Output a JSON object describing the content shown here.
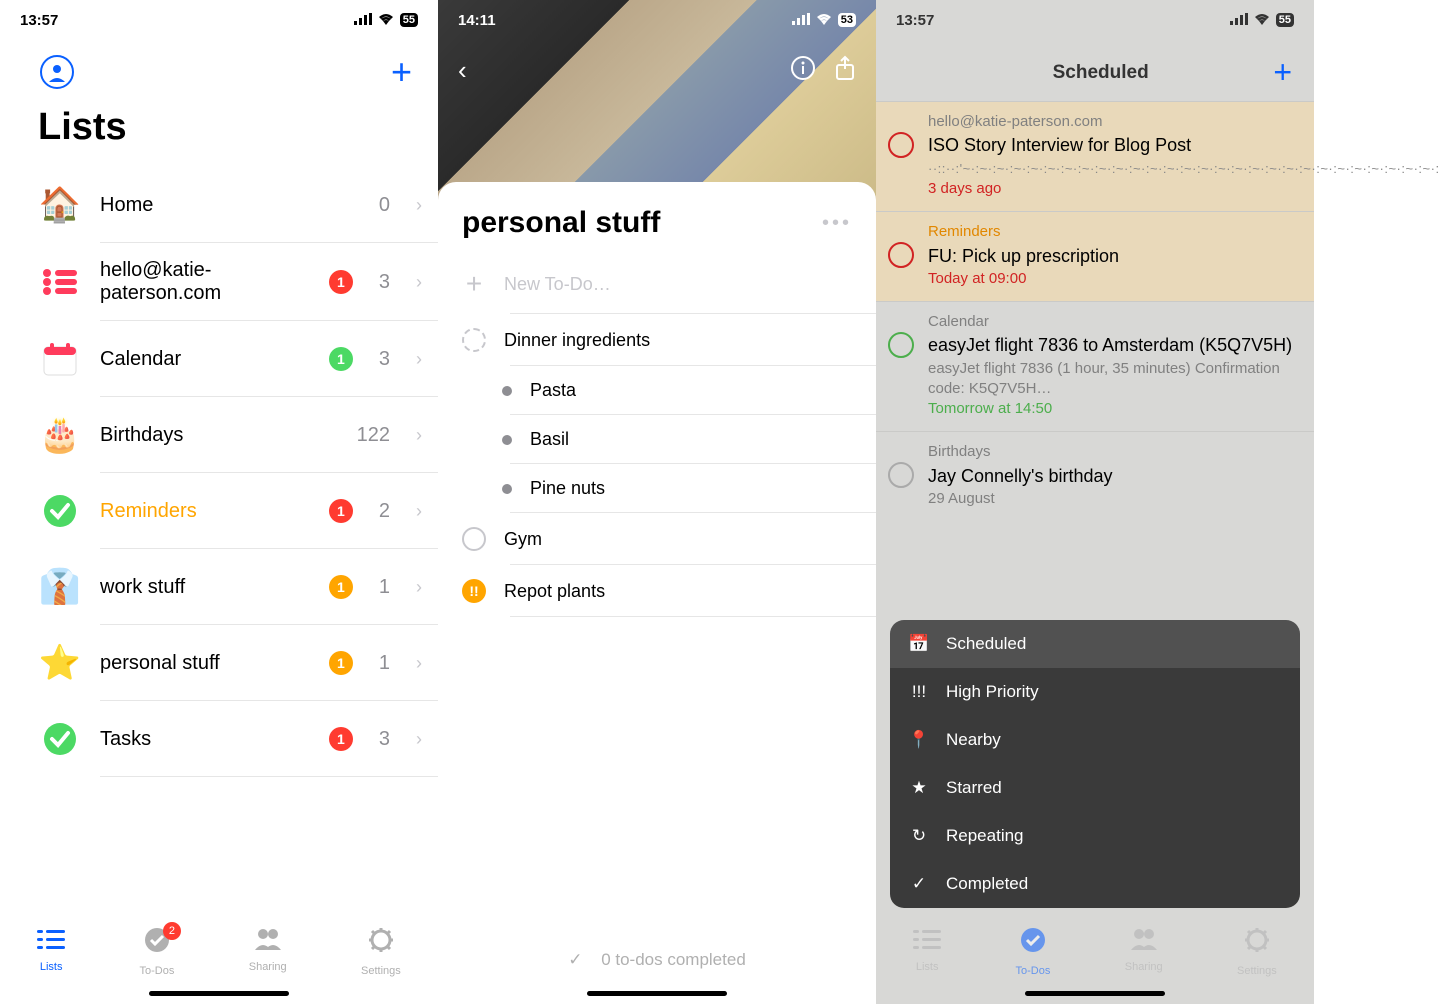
{
  "screen1": {
    "time": "13:57",
    "battery": "55",
    "title": "Lists",
    "lists": [
      {
        "icon": "🏠",
        "label": "Home",
        "badge": null,
        "badgeColor": null,
        "count": "0"
      },
      {
        "icon": "list",
        "label": "hello@katie-paterson.com",
        "badge": "1",
        "badgeColor": "#ff3b30",
        "count": "3"
      },
      {
        "icon": "calendar",
        "label": "Calendar",
        "badge": "1",
        "badgeColor": "#4cd964",
        "count": "3"
      },
      {
        "icon": "🎂",
        "label": "Birthdays",
        "badge": null,
        "badgeColor": null,
        "count": "122"
      },
      {
        "icon": "check",
        "label": "Reminders",
        "labelColor": "#ffa500",
        "badge": "1",
        "badgeColor": "#ff3b30",
        "count": "2"
      },
      {
        "icon": "👔",
        "label": "work stuff",
        "badge": "1",
        "badgeColor": "#ffa500",
        "count": "1"
      },
      {
        "icon": "⭐",
        "label": "personal stuff",
        "badge": "1",
        "badgeColor": "#ffa500",
        "count": "1"
      },
      {
        "icon": "check",
        "label": "Tasks",
        "badge": "1",
        "badgeColor": "#ff3b30",
        "count": "3"
      }
    ],
    "tabs": [
      {
        "label": "Lists",
        "active": true,
        "badge": null
      },
      {
        "label": "To-Dos",
        "active": false,
        "badge": "2"
      },
      {
        "label": "Sharing",
        "active": false,
        "badge": null
      },
      {
        "label": "Settings",
        "active": false,
        "badge": null
      }
    ]
  },
  "screen2": {
    "time": "14:11",
    "battery": "53",
    "title": "personal stuff",
    "newTodo": "New To-Do…",
    "todos": [
      {
        "type": "dashed",
        "label": "Dinner ingredients"
      },
      {
        "type": "bullet",
        "label": "Pasta"
      },
      {
        "type": "bullet",
        "label": "Basil"
      },
      {
        "type": "bullet",
        "label": "Pine nuts"
      },
      {
        "type": "circle",
        "label": "Gym"
      },
      {
        "type": "alert",
        "label": "Repot plants"
      }
    ],
    "footer": "0 to-dos completed"
  },
  "screen3": {
    "time": "13:57",
    "battery": "55",
    "title": "Scheduled",
    "items": [
      {
        "src": "hello@katie-paterson.com",
        "srcColor": "#808080",
        "title": "ISO Story Interview for Blog Post",
        "sep": "··::··:'~·:~·:~·:~·:~·:~·:~·:~·:~·:~·:~·:~·:~·:~·:~·:~·:~·:~·:~·:~·:~·:~·:~·:~·:~·:~·:~·:~·:~·:~·:~·:~·:~…",
        "when": "3 days ago",
        "whenColor": "#d12323",
        "circleColor": "#d12323",
        "bg": "#e9d9ba"
      },
      {
        "src": "Reminders",
        "srcColor": "#e18700",
        "title": "FU: Pick up prescription",
        "when": "Today at 09:00",
        "whenColor": "#d12323",
        "circleColor": "#d12323",
        "bg": "#e9d9ba"
      },
      {
        "src": "Calendar",
        "srcColor": "#808080",
        "title": "easyJet flight 7836 to Amsterdam (K5Q7V5H)",
        "desc": "easyJet flight 7836 (1 hour, 35 minutes) Confirmation code: K5Q7V5H…",
        "when": "Tomorrow at 14:50",
        "whenColor": "#4cae4c",
        "circleColor": "#4cae4c",
        "bg": "transparent"
      },
      {
        "src": "Birthdays",
        "srcColor": "#808080",
        "title": "Jay Connelly's birthday",
        "when": "29 August",
        "whenColor": "#808080",
        "circleColor": "#aaa",
        "bg": "transparent"
      }
    ],
    "popup": [
      {
        "icon": "📅",
        "label": "Scheduled",
        "sel": true
      },
      {
        "icon": "!!!",
        "label": "High Priority"
      },
      {
        "icon": "📍",
        "label": "Nearby"
      },
      {
        "icon": "★",
        "label": "Starred"
      },
      {
        "icon": "↻",
        "label": "Repeating"
      },
      {
        "icon": "✓",
        "label": "Completed"
      }
    ],
    "tabs": [
      {
        "label": "Lists",
        "active": false
      },
      {
        "label": "To-Dos",
        "active": true
      },
      {
        "label": "Sharing",
        "active": false
      },
      {
        "label": "Settings",
        "active": false
      }
    ]
  }
}
